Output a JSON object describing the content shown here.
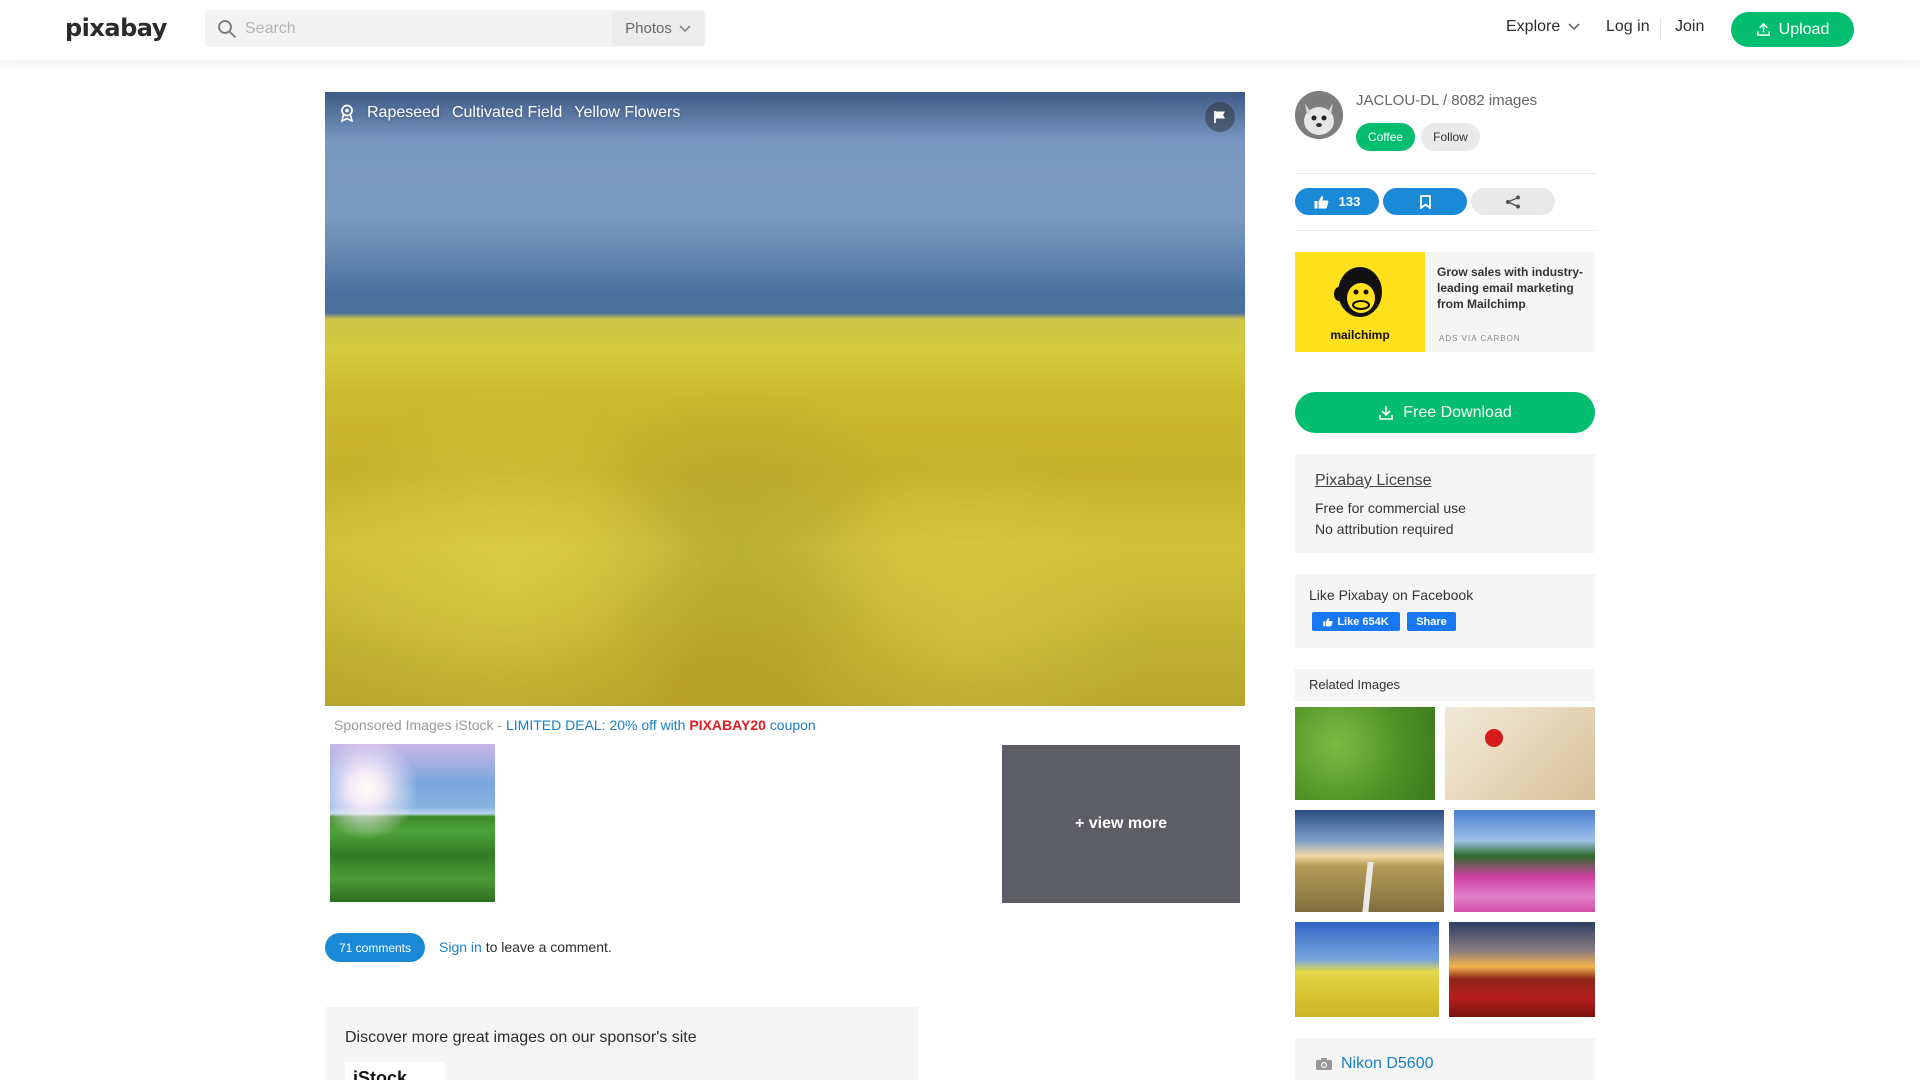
{
  "header": {
    "logo": "pixabay",
    "search_placeholder": "Search",
    "search_type": "Photos",
    "nav": {
      "explore": "Explore",
      "login": "Log in",
      "join": "Join",
      "upload": "Upload"
    }
  },
  "photo": {
    "tags": [
      "Rapeseed",
      "Cultivated Field",
      "Yellow Flowers"
    ]
  },
  "sponsored": {
    "prefix": "Sponsored Images iStock - ",
    "deal": "LIMITED DEAL: 20% off with ",
    "code": "PIXABAY20",
    "suffix": " coupon",
    "view_more": "+ view more"
  },
  "comments": {
    "count_label": "71 comments",
    "signin": "Sign in",
    "hint": " to leave a comment."
  },
  "discover": {
    "title": "Discover more great images on our sponsor's site",
    "logo": "iStock"
  },
  "author": {
    "line": "JACLOU-DL / 8082 images",
    "coffee": "Coffee",
    "follow": "Follow"
  },
  "actions": {
    "likes": "133"
  },
  "ad": {
    "brand": "mailchimp",
    "text": "Grow sales with industry-leading email marketing from Mailchimp",
    "via": "ADS VIA CARBON"
  },
  "download": {
    "label": "Free Download"
  },
  "license": {
    "title": "Pixabay License",
    "line1": "Free for commercial use",
    "line2": "No attribution required"
  },
  "facebook": {
    "title": "Like Pixabay on Facebook",
    "like": "Like 654K",
    "share": "Share"
  },
  "related": {
    "title": "Related Images"
  },
  "camera": {
    "model": "Nikon D5600"
  },
  "colors": {
    "green": "#02be6e",
    "blue": "#1a8ad6",
    "red_code": "#e01b22"
  }
}
